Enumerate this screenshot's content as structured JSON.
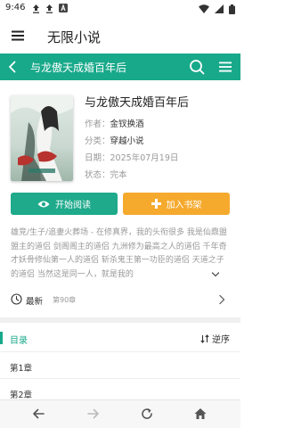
{
  "status_bar": {
    "time": "9:46",
    "left_icons": [
      "upload-icon",
      "upload-icon",
      "a-badge-icon"
    ],
    "right_icons": [
      "wifi-icon",
      "signal-icon",
      "battery-icon"
    ]
  },
  "app_bar": {
    "title": "无限小说"
  },
  "book_header": {
    "title": "与龙傲天成婚百年后"
  },
  "book": {
    "title": "与龙傲天成婚百年后",
    "author_label": "作者：",
    "author": "金钗换酒",
    "category_label": "分类：",
    "category": "穿越小说",
    "date_label": "日期：",
    "date": "2025年07月19日",
    "status_label": "状态：",
    "status": "完本"
  },
  "actions": {
    "read_label": "开始阅读",
    "shelf_label": "加入书架"
  },
  "description": "雄竞/生子/追妻火葬场 - 在修真界，我的头衔很多 我是仙鼎盟盟主的道侣 剑阁阁主的道侣 九洲修为最高之人的道侣 千年奇才妖骨修仙第一人的道侣 斩杀鬼王第一功臣的道侣 天道之子的道侣 当然这是同一人，就是我的",
  "latest": {
    "label": "最新",
    "chapter": "第90章"
  },
  "toc": {
    "label": "目录",
    "sort_label": "逆序",
    "chapters": [
      "第1章",
      "第2章"
    ]
  },
  "colors": {
    "teal": "#18a98a",
    "orange": "#f5aa2e"
  }
}
